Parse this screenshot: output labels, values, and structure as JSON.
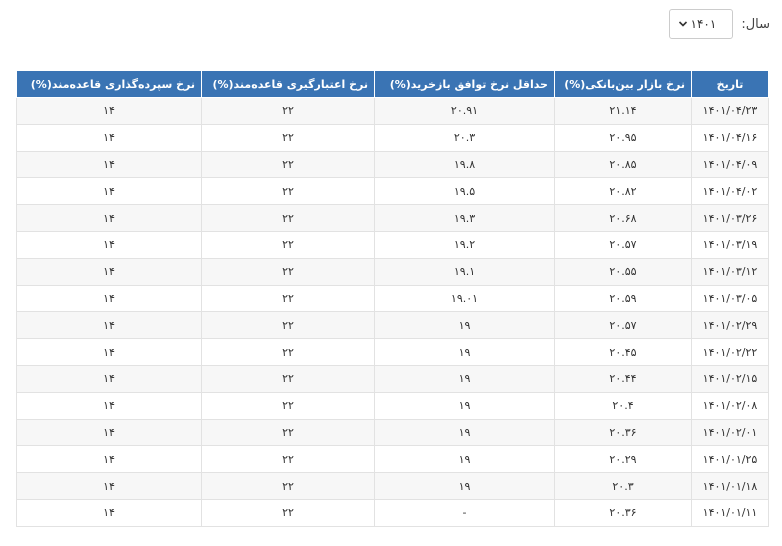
{
  "filter": {
    "label": "سال:",
    "selected_year": "۱۴۰۱"
  },
  "table": {
    "headers": [
      "تاریخ",
      "نرخ بازار بین‌بانکی(%)",
      "حداقل نرخ توافق بازخرید(%)",
      "نرخ اعتبارگیری قاعده‌مند(%)",
      "نرخ سپرده‌گذاری قاعده‌مند(%)"
    ],
    "rows": [
      [
        "۱۴۰۱/۰۴/۲۳",
        "۲۱.۱۴",
        "۲۰.۹۱",
        "۲۲",
        "۱۴"
      ],
      [
        "۱۴۰۱/۰۴/۱۶",
        "۲۰.۹۵",
        "۲۰.۳",
        "۲۲",
        "۱۴"
      ],
      [
        "۱۴۰۱/۰۴/۰۹",
        "۲۰.۸۵",
        "۱۹.۸",
        "۲۲",
        "۱۴"
      ],
      [
        "۱۴۰۱/۰۴/۰۲",
        "۲۰.۸۲",
        "۱۹.۵",
        "۲۲",
        "۱۴"
      ],
      [
        "۱۴۰۱/۰۳/۲۶",
        "۲۰.۶۸",
        "۱۹.۳",
        "۲۲",
        "۱۴"
      ],
      [
        "۱۴۰۱/۰۳/۱۹",
        "۲۰.۵۷",
        "۱۹.۲",
        "۲۲",
        "۱۴"
      ],
      [
        "۱۴۰۱/۰۳/۱۲",
        "۲۰.۵۵",
        "۱۹.۱",
        "۲۲",
        "۱۴"
      ],
      [
        "۱۴۰۱/۰۳/۰۵",
        "۲۰.۵۹",
        "۱۹.۰۱",
        "۲۲",
        "۱۴"
      ],
      [
        "۱۴۰۱/۰۲/۲۹",
        "۲۰.۵۷",
        "۱۹",
        "۲۲",
        "۱۴"
      ],
      [
        "۱۴۰۱/۰۲/۲۲",
        "۲۰.۴۵",
        "۱۹",
        "۲۲",
        "۱۴"
      ],
      [
        "۱۴۰۱/۰۲/۱۵",
        "۲۰.۴۴",
        "۱۹",
        "۲۲",
        "۱۴"
      ],
      [
        "۱۴۰۱/۰۲/۰۸",
        "۲۰.۴",
        "۱۹",
        "۲۲",
        "۱۴"
      ],
      [
        "۱۴۰۱/۰۲/۰۱",
        "۲۰.۳۶",
        "۱۹",
        "۲۲",
        "۱۴"
      ],
      [
        "۱۴۰۱/۰۱/۲۵",
        "۲۰.۲۹",
        "۱۹",
        "۲۲",
        "۱۴"
      ],
      [
        "۱۴۰۱/۰۱/۱۸",
        "۲۰.۳",
        "۱۹",
        "۲۲",
        "۱۴"
      ],
      [
        "۱۴۰۱/۰۱/۱۱",
        "۲۰.۳۶",
        "-",
        "۲۲",
        "۱۴"
      ]
    ]
  },
  "icons": {
    "dropdown": "chevron-down-icon"
  },
  "colors": {
    "header_bg": "#3a74b4",
    "header_text": "#ffffff",
    "row_alt": "#f7f7f7"
  }
}
